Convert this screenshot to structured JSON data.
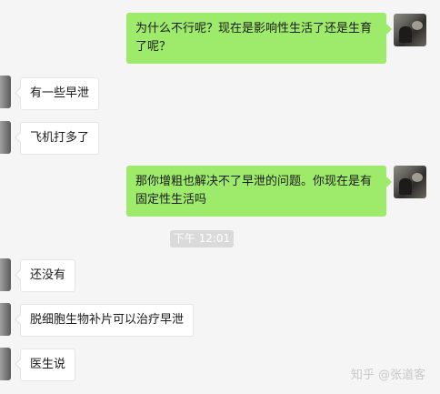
{
  "chat": {
    "messages": [
      {
        "side": "out",
        "text": "为什么不行呢？现在是影响性生活了还是生育了呢？"
      },
      {
        "side": "in",
        "text": "有一些早泄"
      },
      {
        "side": "in",
        "text": "飞机打多了"
      },
      {
        "side": "out",
        "text": "那你增粗也解决不了早泄的问题。你现在是有固定性生活吗"
      },
      {
        "side": "in",
        "text": "还没有"
      },
      {
        "side": "in",
        "text": "脱细胞生物补片可以治疗早泄"
      },
      {
        "side": "in",
        "text": "医生说"
      }
    ],
    "timestamp": "下午 12:01"
  },
  "watermark": "知乎 @张道客",
  "colors": {
    "background": "#f5f5f5",
    "outgoing_bubble": "#9eea6a",
    "incoming_bubble": "#ffffff",
    "timestamp_badge": "#dadada"
  },
  "icons": {
    "self_avatar": "user-avatar-photo",
    "contact_avatar": "contact-avatar-photo"
  }
}
